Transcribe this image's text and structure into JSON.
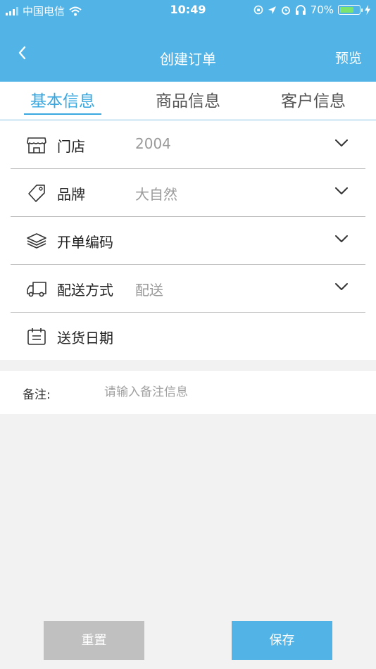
{
  "status_bar": {
    "carrier": "中国电信",
    "time": "10:49",
    "battery": "70%",
    "battery_level": 0.7
  },
  "navbar": {
    "title": "创建订单",
    "right_action": "预览"
  },
  "tabs": [
    {
      "label": "基本信息",
      "active": true
    },
    {
      "label": "商品信息",
      "active": false
    },
    {
      "label": "客户信息",
      "active": false
    }
  ],
  "form": {
    "rows": [
      {
        "icon": "store-icon",
        "label": "门店",
        "value": "2004",
        "has_dropdown": true
      },
      {
        "icon": "tag-icon",
        "label": "品牌",
        "value": "大自然",
        "has_dropdown": true
      },
      {
        "icon": "layers-icon",
        "label": "开单编码",
        "value": "",
        "has_dropdown": true
      },
      {
        "icon": "truck-icon",
        "label": "配送方式",
        "value": "配送",
        "has_dropdown": true
      },
      {
        "icon": "calendar-icon",
        "label": "送货日期",
        "value": "",
        "has_dropdown": false
      }
    ]
  },
  "remark": {
    "label": "备注:",
    "placeholder": "请输入备注信息",
    "value": ""
  },
  "buttons": {
    "reset": "重置",
    "save": "保存"
  },
  "colors": {
    "primary": "#52b4e6",
    "tab_active": "#3aa8e0",
    "reset_button": "#c0c0c0"
  }
}
